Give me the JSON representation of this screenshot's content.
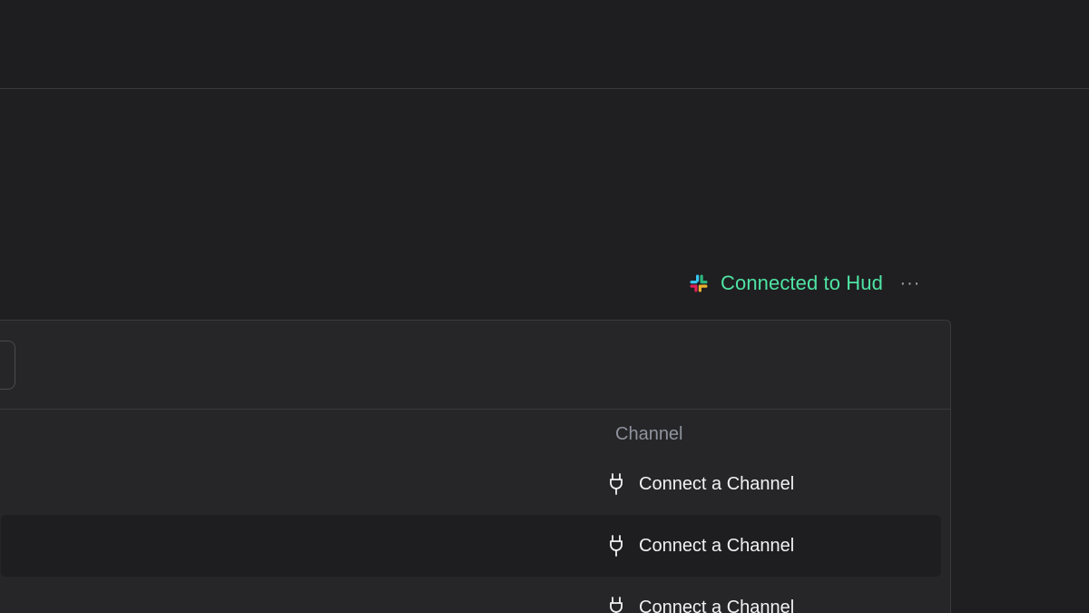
{
  "integration": {
    "status_text": "Connected to Hud",
    "more_label": "···",
    "status_color": "#4fe3a4",
    "icon": "slack-icon"
  },
  "table": {
    "column_header": "Channel",
    "rows": [
      {
        "action_label": "Connect a Channel",
        "icon": "plug-icon"
      },
      {
        "action_label": "Connect a Channel",
        "icon": "plug-icon"
      },
      {
        "action_label": "Connect a Channel",
        "icon": "plug-icon"
      }
    ]
  }
}
